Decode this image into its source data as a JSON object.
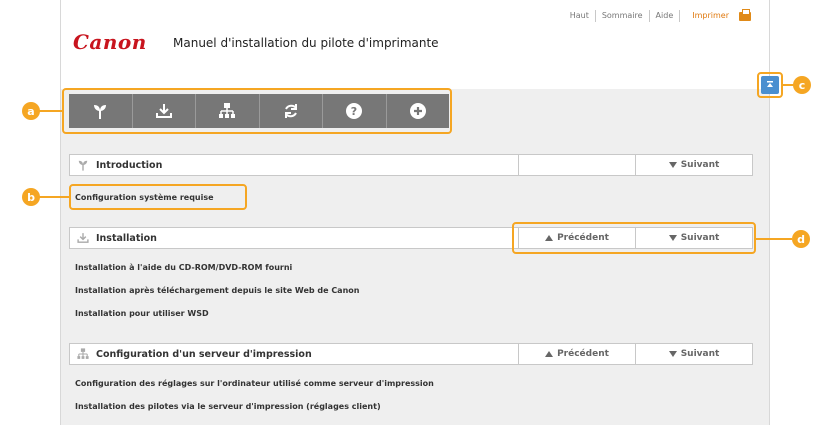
{
  "header": {
    "logo": "Canon",
    "title": "Manuel d'installation du pilote d'imprimante",
    "nav": {
      "haut": "Haut",
      "sommaire": "Sommaire",
      "aide": "Aide",
      "imprimer": "Imprimer"
    }
  },
  "toolbar": {
    "icons": [
      "sprout-icon",
      "download-icon",
      "network-icon",
      "refresh-icon",
      "help-icon",
      "plus-icon"
    ]
  },
  "sections": {
    "intro": {
      "title": "Introduction",
      "next": "Suivant"
    },
    "intro_links": [
      "Configuration système requise"
    ],
    "install": {
      "title": "Installation",
      "prev": "Précédent",
      "next": "Suivant"
    },
    "install_links": [
      "Installation à l'aide du CD-ROM/DVD-ROM fourni",
      "Installation après téléchargement depuis le site Web de Canon",
      "Installation pour utiliser WSD"
    ],
    "server": {
      "title": "Configuration d'un serveur d'impression",
      "prev": "Précédent",
      "next": "Suivant"
    },
    "server_links": [
      "Configuration des réglages sur l'ordinateur utilisé comme serveur d'impression",
      "Installation des pilotes via le serveur d'impression (réglages client)"
    ]
  },
  "callouts": {
    "a": "a",
    "b": "b",
    "c": "c",
    "d": "d"
  },
  "colors": {
    "brand": "#c8141e",
    "callout": "#f5a623",
    "toolbar": "#777777",
    "print": "#e07a10"
  }
}
